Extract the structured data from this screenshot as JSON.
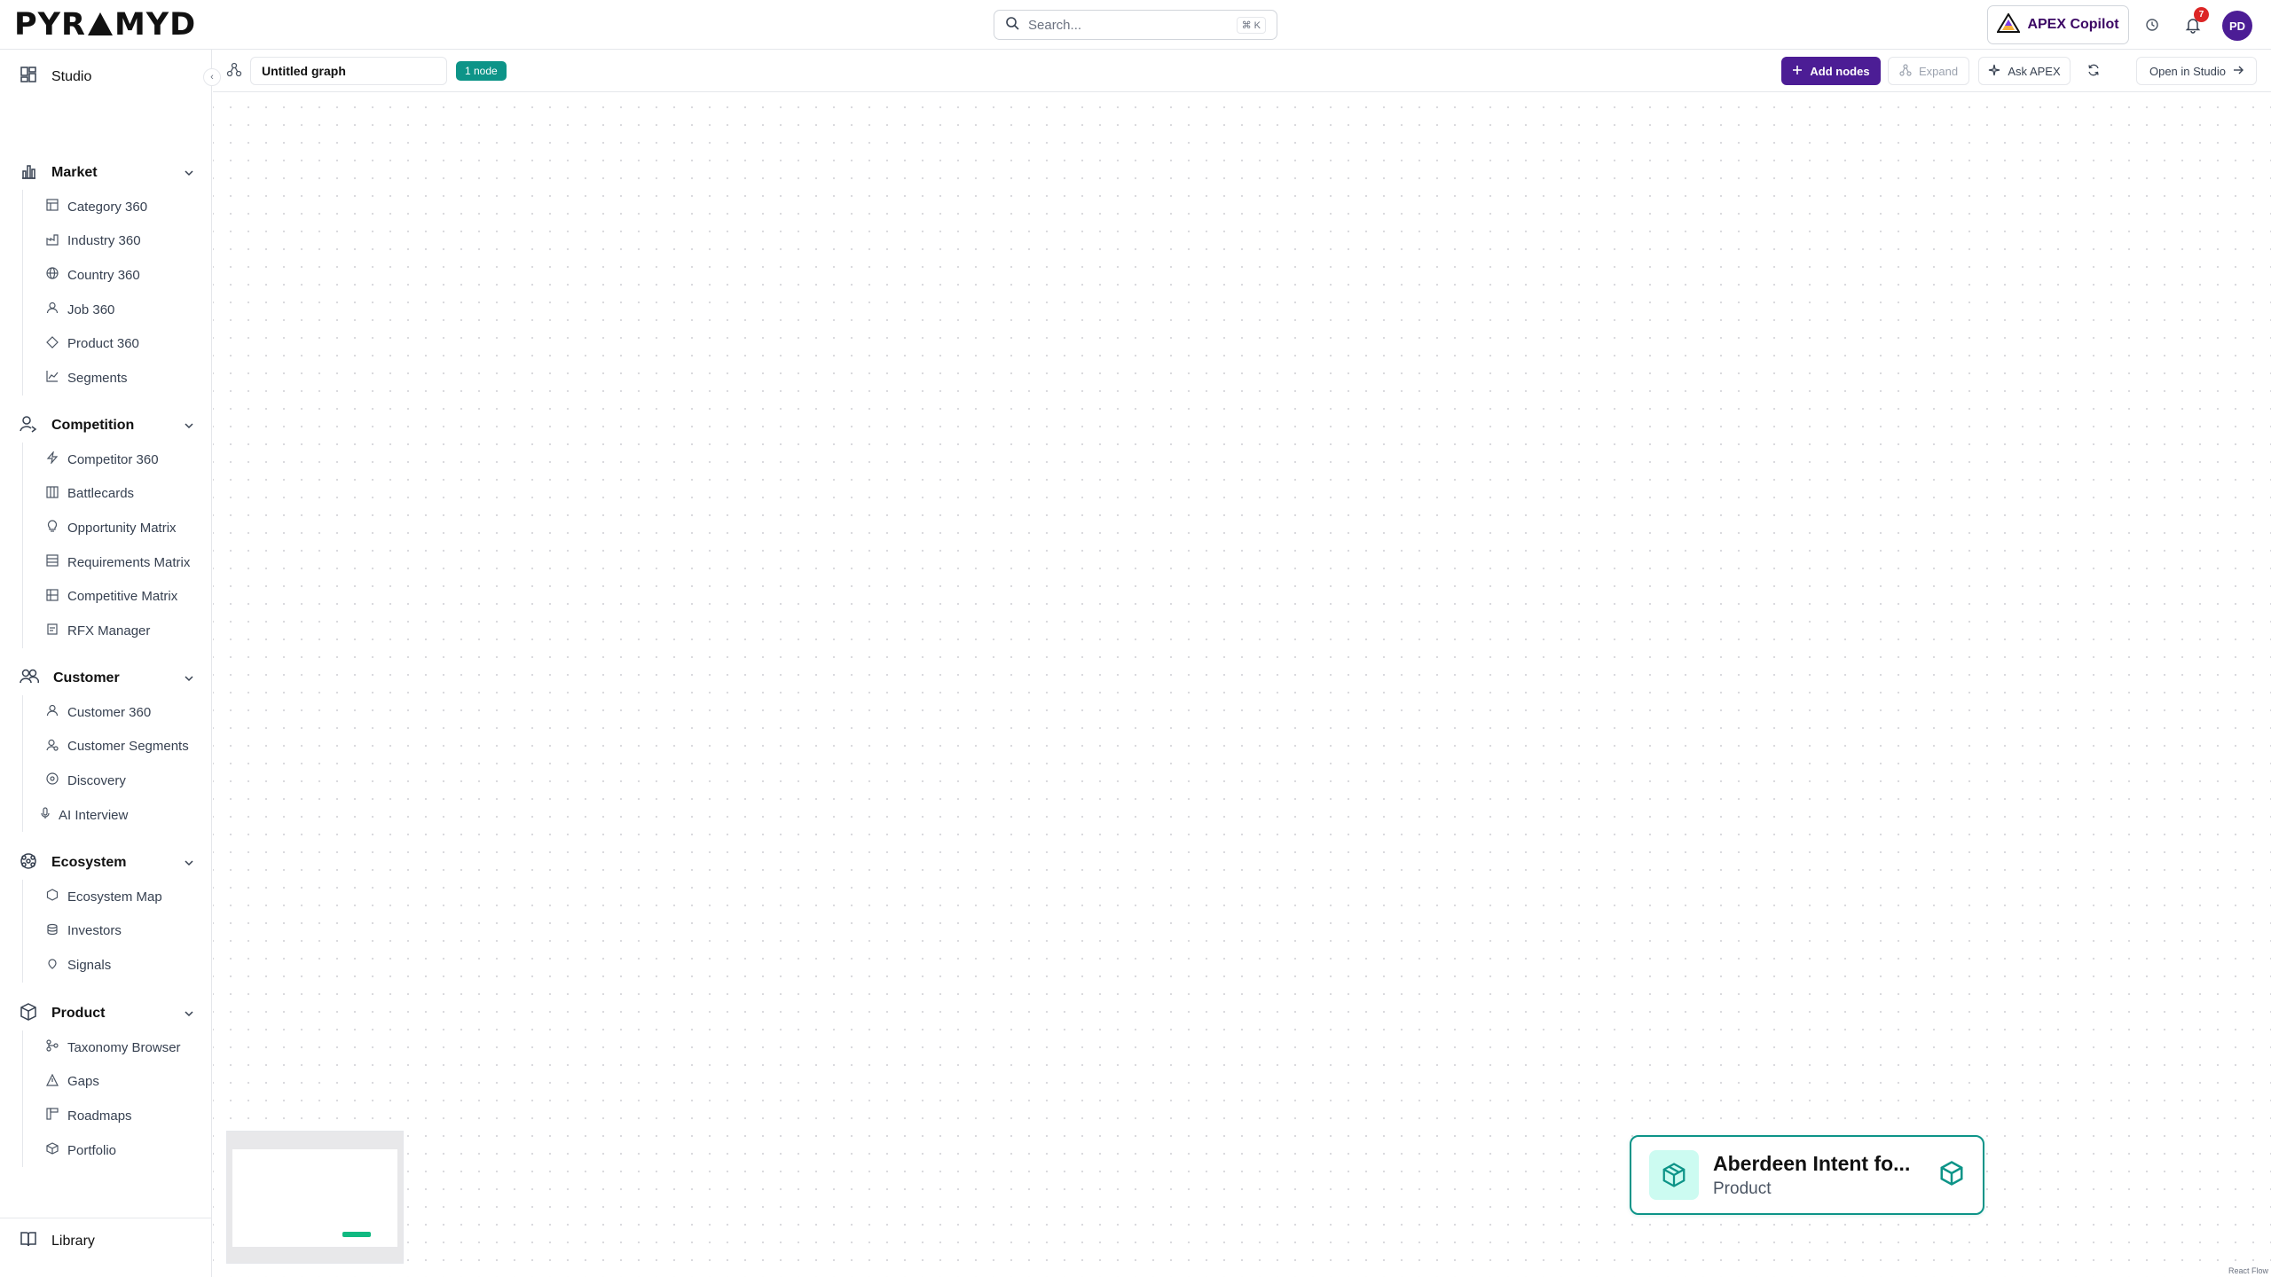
{
  "topbar": {
    "logo_left": "PYR",
    "logo_right": "MYD",
    "search_placeholder": "Search...",
    "search_shortcut": "⌘ K",
    "copilot_label": "APEX Copilot",
    "notification_count": "7",
    "avatar_initials": "PD"
  },
  "sidebar": {
    "studio": "Studio",
    "sections": {
      "market": {
        "label": "Market",
        "items": [
          "Category 360",
          "Industry 360",
          "Country 360",
          "Job 360",
          "Product 360",
          "Segments"
        ]
      },
      "competition": {
        "label": "Competition",
        "items": [
          "Competitor 360",
          "Battlecards",
          "Opportunity Matrix",
          "Requirements Matrix",
          "Competitive Matrix",
          "RFX Manager"
        ]
      },
      "customer": {
        "label": "Customer",
        "items": [
          "Customer 360",
          "Customer Segments",
          "Discovery",
          "AI Interview"
        ]
      },
      "ecosystem": {
        "label": "Ecosystem",
        "items": [
          "Ecosystem Map",
          "Investors",
          "Signals"
        ]
      },
      "product": {
        "label": "Product",
        "items": [
          "Taxonomy Browser",
          "Gaps",
          "Roadmaps",
          "Portfolio"
        ]
      }
    },
    "library": "Library"
  },
  "toolbar": {
    "graph_title": "Untitled graph",
    "node_count": "1 node",
    "add_nodes": "Add nodes",
    "expand": "Expand",
    "ask_apex": "Ask APEX",
    "open_in_studio": "Open in Studio"
  },
  "canvas": {
    "node": {
      "title": "Aberdeen Intent fo...",
      "type": "Product"
    },
    "attribution": "React Flow"
  },
  "colors": {
    "accent": "#4c1d95",
    "node": "#0d9488",
    "badge": "#dc2626"
  }
}
